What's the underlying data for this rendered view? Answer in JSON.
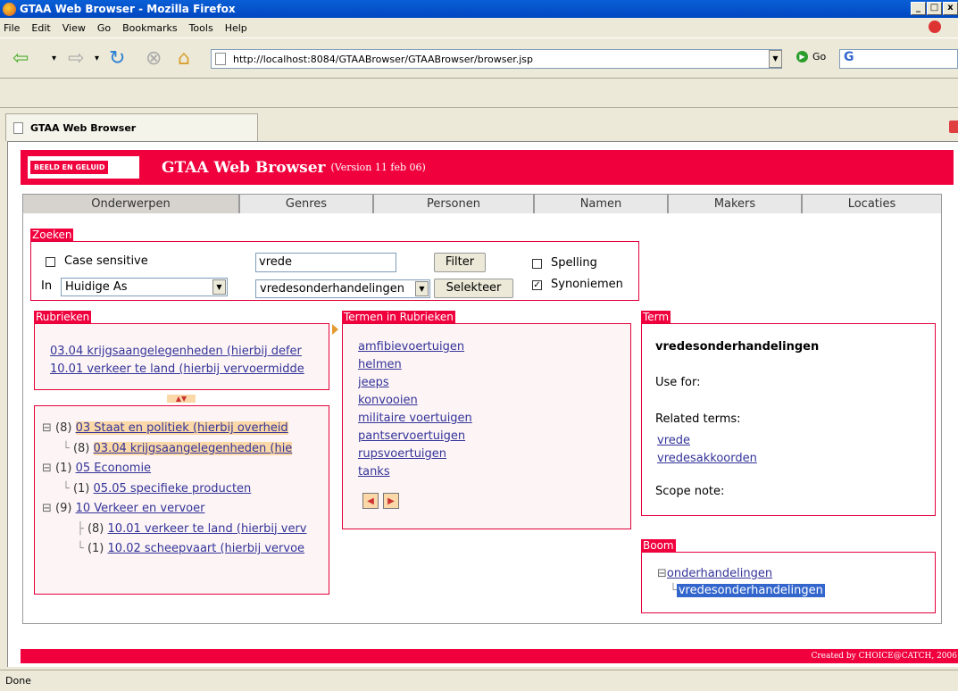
{
  "window": {
    "title": "GTAA Web Browser - Mozilla Firefox"
  },
  "menu": [
    "File",
    "Edit",
    "View",
    "Go",
    "Bookmarks",
    "Tools",
    "Help"
  ],
  "toolbar": {
    "url": "http://localhost:8084/GTAABrowser/GTAABrowser/browser.jsp",
    "go_label": "Go",
    "search_value": "G"
  },
  "browser_tab": {
    "label": "GTAA Web Browser"
  },
  "status": "Done",
  "banner": {
    "logo": "BEELD EN GELUID",
    "title": "GTAA Web Browser",
    "version": "(Version 11 feb 06)"
  },
  "tabs": [
    "Onderwerpen",
    "Genres",
    "Personen",
    "Namen",
    "Makers",
    "Locaties"
  ],
  "zoeken": {
    "legend": "Zoeken",
    "case_label": "Case sensitive",
    "in_label": "In",
    "in_value": "Huidige As",
    "search_value": "vrede",
    "filter_label": "Filter",
    "term_select": "vredesonderhandelingen",
    "selecteer_label": "Selekteer",
    "spelling_label": "Spelling",
    "synoniemen_label": "Synoniemen"
  },
  "rubrieken": {
    "legend": "Rubrieken",
    "items": [
      "03.04 krijgsaangelegenheden (hierbij defer",
      "10.01 verkeer te land (hierbij vervoermidde"
    ]
  },
  "tree": [
    {
      "count": "(8)",
      "label": "03 Staat en politiek (hierbij overheid",
      "level": 0,
      "hl": true
    },
    {
      "count": "(8)",
      "label": "03.04 krijgsaangelegenheden (hie",
      "level": 1,
      "hl": true
    },
    {
      "count": "(1)",
      "label": "05 Economie",
      "level": 0,
      "hl": false
    },
    {
      "count": "(1)",
      "label": "05.05 specifieke producten",
      "level": 1,
      "hl": false
    },
    {
      "count": "(9)",
      "label": "10 Verkeer en vervoer",
      "level": 0,
      "hl": false
    },
    {
      "count": "(8)",
      "label": "10.01 verkeer te land (hierbij verⅴ",
      "level": 1,
      "hl": false
    },
    {
      "count": "(1)",
      "label": "10.02 scheepvaart (hierbij vervoe",
      "level": 1,
      "hl": false
    }
  ],
  "termen": {
    "legend": "Termen in Rubrieken",
    "items": [
      "amfibievoertuigen",
      "helmen",
      "jeeps",
      "konvooien",
      "militaire voertuigen",
      "pantservoertuigen",
      "rupsvoertuigen",
      "tanks"
    ]
  },
  "term": {
    "legend": "Term",
    "name": "vredesonderhandelingen",
    "use_for": "Use for:",
    "related_label": "Related terms:",
    "related": [
      "vrede",
      "vredesakkoorden"
    ],
    "scope": "Scope note:"
  },
  "boom": {
    "legend": "Boom",
    "parent": "onderhandelingen",
    "child": "vredesonderhandelingen"
  },
  "footer": "Created by CHOICE@CATCH, 2006",
  "colors": {
    "brand_red": "#f0003c",
    "link": "#333399",
    "highlight": "#fbd8a8",
    "selection": "#3366cc"
  }
}
